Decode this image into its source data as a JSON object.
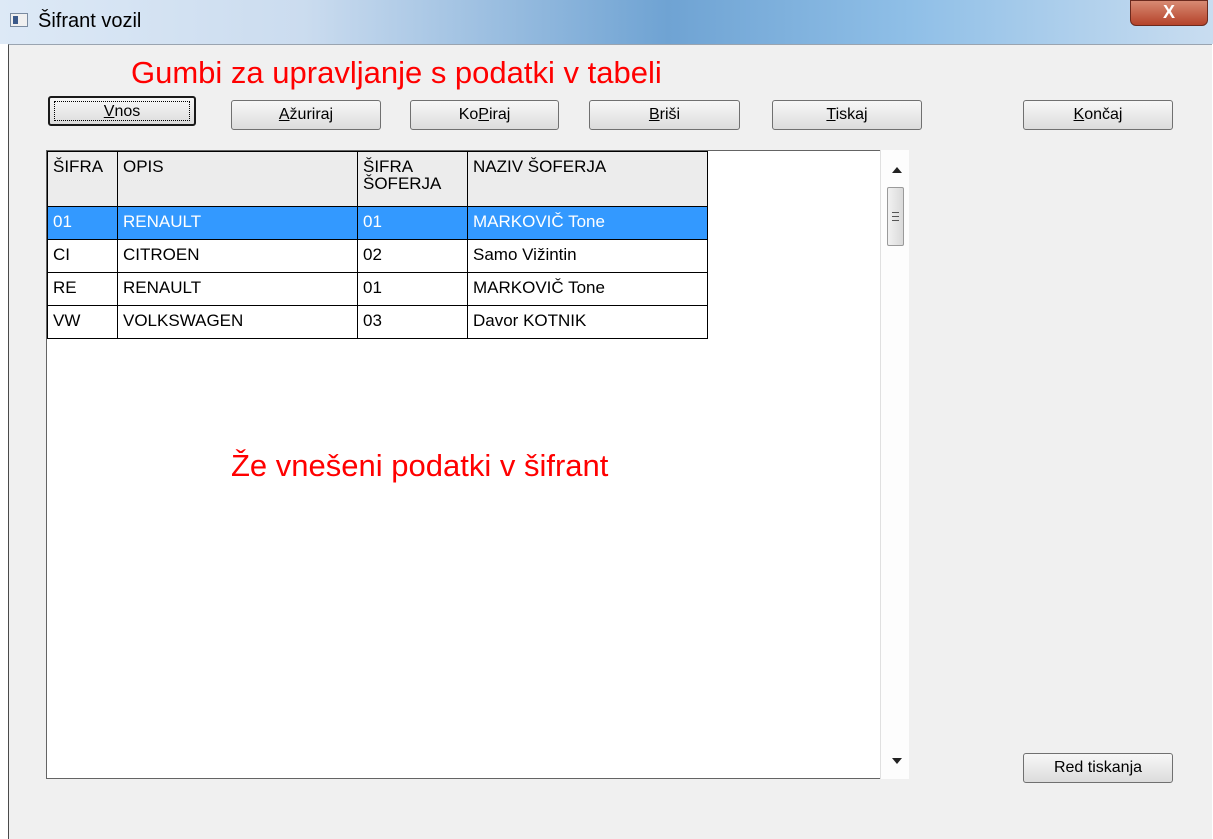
{
  "window": {
    "title": "Šifrant vozil",
    "close_label": "X"
  },
  "annotations": {
    "top": "Gumbi za upravljanje s podatki v tabeli",
    "middle": "Že vnešeni podatki v šifrant"
  },
  "buttons": {
    "vnos": {
      "pre": "",
      "accel": "V",
      "post": "nos"
    },
    "azuriraj": {
      "pre": "",
      "accel": "A",
      "post": "žuriraj"
    },
    "kopiraj": {
      "pre": "Ko",
      "accel": "P",
      "post": "iraj"
    },
    "brisi": {
      "pre": "",
      "accel": "B",
      "post": "riši"
    },
    "tiskaj": {
      "pre": "",
      "accel": "T",
      "post": "iskaj"
    },
    "koncaj": {
      "pre": "",
      "accel": "K",
      "post": "ončaj"
    },
    "red_tiskanja": "Red tiskanja"
  },
  "table": {
    "headers": [
      "ŠIFRA",
      "OPIS",
      "ŠIFRA ŠOFERJA",
      "NAZIV ŠOFERJA"
    ],
    "header_lines": {
      "col3_line1": "ŠIFRA",
      "col3_line2": "ŠOFERJA"
    },
    "rows": [
      [
        "01",
        "RENAULT",
        "01",
        "MARKOVIČ Tone"
      ],
      [
        "CI",
        "CITROEN",
        "02",
        "Samo Vižintin"
      ],
      [
        "RE",
        "RENAULT",
        "01",
        "MARKOVIČ Tone"
      ],
      [
        "VW",
        "VOLKSWAGEN",
        "03",
        "Davor KOTNIK"
      ]
    ],
    "selected_row": 0
  },
  "colors": {
    "annotation": "#ff0000",
    "selection": "#3399ff"
  }
}
